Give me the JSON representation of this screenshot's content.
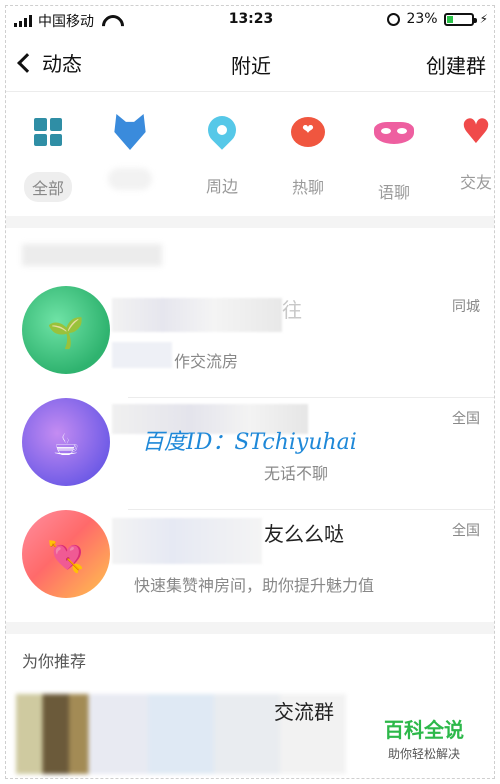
{
  "status_bar": {
    "carrier": "中国移动",
    "time": "13:23",
    "battery_percent": "23%",
    "battery_level": 0.23
  },
  "nav": {
    "back_label": "动态",
    "title": "附近",
    "action_label": "创建群"
  },
  "categories": [
    {
      "label": "全部",
      "icon": "grid-icon",
      "color": "#2f8ea5",
      "active": true
    },
    {
      "label": "",
      "icon": "wolf-icon",
      "color": "#3a8bdc",
      "active": false
    },
    {
      "label": "周边",
      "icon": "location-pin-icon",
      "color": "#56c8e8",
      "active": false
    },
    {
      "label": "热聊",
      "icon": "chat-heart-icon",
      "color": "#f0563f",
      "active": false
    },
    {
      "label": "语聊",
      "icon": "mask-icon",
      "color": "#ee5fa0",
      "active": false
    },
    {
      "label": "交友",
      "icon": "heart-icon",
      "color": "#f04a4a",
      "active": false
    }
  ],
  "groups": [
    {
      "name": "往",
      "desc": "作交流房",
      "tag": "同城",
      "avatar_icon": "plant-pot-icon"
    },
    {
      "name": "",
      "desc": "无话不聊",
      "tag": "全国",
      "avatar_icon": "cup-heart-icon"
    },
    {
      "name": "友么么哒",
      "desc": "快速集赞神房间，助你提升魅力值",
      "tag": "全国",
      "avatar_icon": "heart-arrow-icon"
    }
  ],
  "watermark": "百度ID：STchiyuhai",
  "recommend": {
    "title": "为你推荐",
    "first_name": "交流群"
  },
  "baike": {
    "title": "百科全说",
    "subtitle": "助你轻松解决"
  }
}
